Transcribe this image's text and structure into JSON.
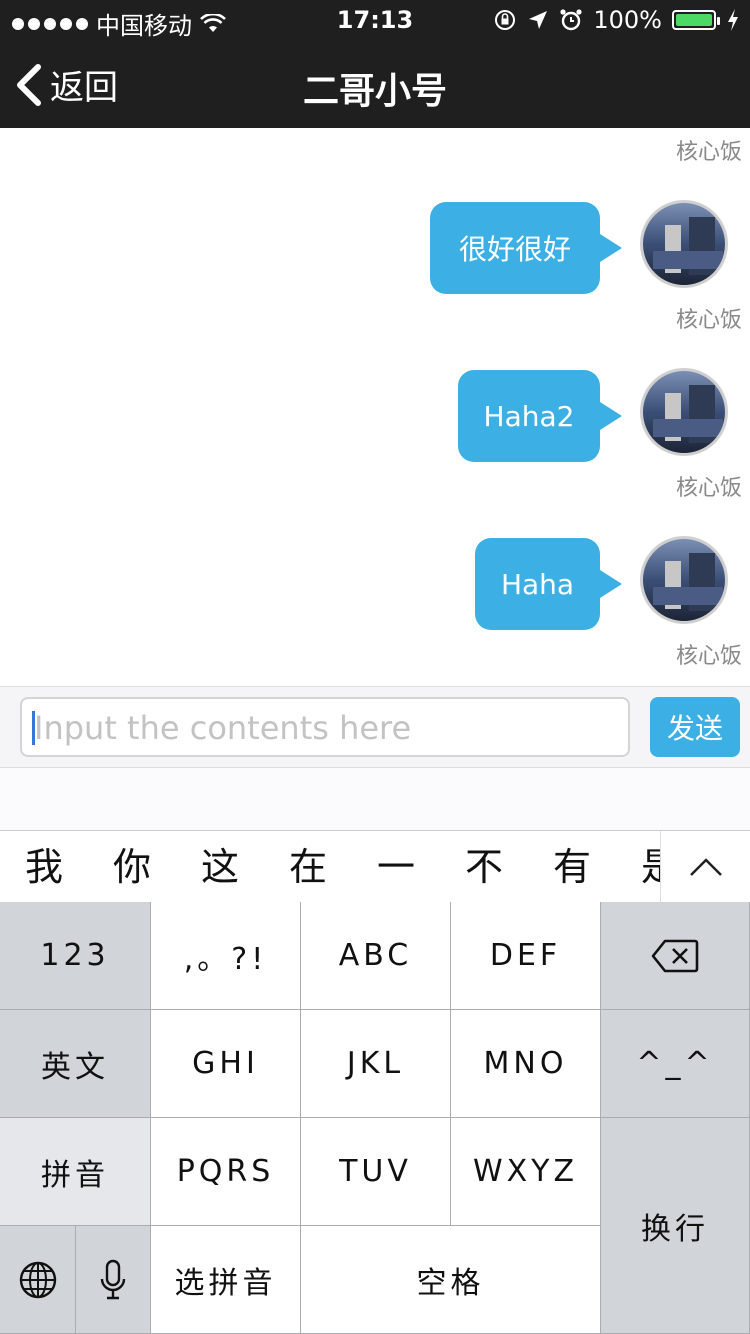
{
  "status_bar": {
    "carrier": "中国移动",
    "time": "17:13",
    "battery": "100%"
  },
  "nav": {
    "back_label": "返回",
    "title": "二哥小号"
  },
  "chat": {
    "top_sender": "核心饭",
    "messages": [
      {
        "text": "很好很好",
        "sender": "核心饭"
      },
      {
        "text": "Haha2",
        "sender": "核心饭"
      },
      {
        "text": "Haha",
        "sender": "核心饭"
      }
    ]
  },
  "composer": {
    "placeholder": "Input the contents here",
    "send_label": "发送"
  },
  "candidates": [
    "我",
    "你",
    "这",
    "在",
    "一",
    "不",
    "有",
    "是"
  ],
  "keyboard": {
    "k_123": "123",
    "k_punct": ",。?!",
    "k_abc": "ABC",
    "k_def": "DEF",
    "k_english": "英文",
    "k_ghi": "GHI",
    "k_jkl": "JKL",
    "k_mno": "MNO",
    "k_emoji": "^_^",
    "k_pinyin": "拼音",
    "k_pqrs": "PQRS",
    "k_tuv": "TUV",
    "k_wxyz": "WXYZ",
    "k_return": "换行",
    "k_select_pinyin": "选拼音",
    "k_space": "空格"
  },
  "colors": {
    "accent": "#3cb0e5",
    "nav_bg": "#1f1f1f"
  }
}
